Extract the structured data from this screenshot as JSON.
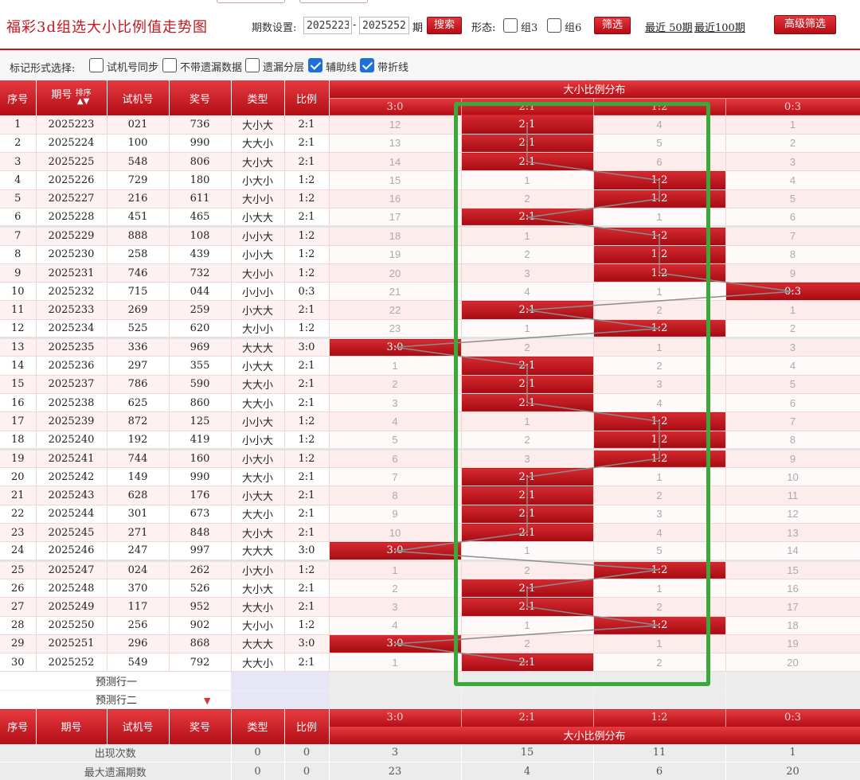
{
  "header": {
    "title": "福彩3d组选大小比例值走势图",
    "period_label": "期数设置:",
    "period_start": "2025223",
    "period_end": "2025252",
    "period_unit": "期",
    "search_label": "搜索",
    "shape_label": "形态:",
    "group3_label": "组3",
    "group6_label": "组6",
    "filter_label": "筛选",
    "recent50_label": "最近 50期",
    "recent100_label": "最近100期",
    "advanced_label": "高级筛选"
  },
  "options": {
    "label": "标记形式选择:",
    "items": [
      {
        "label": "试机号同步",
        "checked": false
      },
      {
        "label": "不带遗漏数据",
        "checked": false
      },
      {
        "label": "遗漏分层",
        "checked": false
      },
      {
        "label": "辅助线",
        "checked": true
      },
      {
        "label": "带折线",
        "checked": true
      }
    ]
  },
  "table": {
    "col_index": "序号",
    "col_period": "期号",
    "sort_label": "排序",
    "col_trial": "试机号",
    "col_prize": "奖号",
    "col_type": "类型",
    "col_ratio": "比例",
    "dist_title": "大小比例分布",
    "dist_cols": [
      "3:0",
      "2:1",
      "1:2",
      "0:3"
    ],
    "rows": [
      {
        "idx": "1",
        "period": "2025223",
        "trial": "021",
        "prize": "736",
        "type": "大小大",
        "ratio": "2:1",
        "dist": [
          "12",
          "2:1",
          "4",
          "1"
        ]
      },
      {
        "idx": "2",
        "period": "2025224",
        "trial": "100",
        "prize": "990",
        "type": "大大小",
        "ratio": "2:1",
        "dist": [
          "13",
          "2:1",
          "5",
          "2"
        ]
      },
      {
        "idx": "3",
        "period": "2025225",
        "trial": "548",
        "prize": "806",
        "type": "大小大",
        "ratio": "2:1",
        "dist": [
          "14",
          "2:1",
          "6",
          "3"
        ]
      },
      {
        "idx": "4",
        "period": "2025226",
        "trial": "729",
        "prize": "180",
        "type": "小大小",
        "ratio": "1:2",
        "dist": [
          "15",
          "1",
          "1:2",
          "4"
        ]
      },
      {
        "idx": "5",
        "period": "2025227",
        "trial": "216",
        "prize": "611",
        "type": "大小小",
        "ratio": "1:2",
        "dist": [
          "16",
          "2",
          "1:2",
          "5"
        ]
      },
      {
        "idx": "6",
        "period": "2025228",
        "trial": "451",
        "prize": "465",
        "type": "小大大",
        "ratio": "2:1",
        "dist": [
          "17",
          "2:1",
          "1",
          "6"
        ]
      },
      {
        "idx": "7",
        "period": "2025229",
        "trial": "888",
        "prize": "108",
        "type": "小小大",
        "ratio": "1:2",
        "dist": [
          "18",
          "1",
          "1:2",
          "7"
        ]
      },
      {
        "idx": "8",
        "period": "2025230",
        "trial": "258",
        "prize": "439",
        "type": "小小大",
        "ratio": "1:2",
        "dist": [
          "19",
          "2",
          "1:2",
          "8"
        ]
      },
      {
        "idx": "9",
        "period": "2025231",
        "trial": "746",
        "prize": "732",
        "type": "大小小",
        "ratio": "1:2",
        "dist": [
          "20",
          "3",
          "1:2",
          "9"
        ]
      },
      {
        "idx": "10",
        "period": "2025232",
        "trial": "715",
        "prize": "044",
        "type": "小小小",
        "ratio": "0:3",
        "dist": [
          "21",
          "4",
          "1",
          "0:3"
        ]
      },
      {
        "idx": "11",
        "period": "2025233",
        "trial": "269",
        "prize": "259",
        "type": "小大大",
        "ratio": "2:1",
        "dist": [
          "22",
          "2:1",
          "2",
          "1"
        ]
      },
      {
        "idx": "12",
        "period": "2025234",
        "trial": "525",
        "prize": "620",
        "type": "大小小",
        "ratio": "1:2",
        "dist": [
          "23",
          "1",
          "1:2",
          "2"
        ]
      },
      {
        "idx": "13",
        "period": "2025235",
        "trial": "336",
        "prize": "969",
        "type": "大大大",
        "ratio": "3:0",
        "dist": [
          "3:0",
          "2",
          "1",
          "3"
        ]
      },
      {
        "idx": "14",
        "period": "2025236",
        "trial": "297",
        "prize": "355",
        "type": "小大大",
        "ratio": "2:1",
        "dist": [
          "1",
          "2:1",
          "2",
          "4"
        ]
      },
      {
        "idx": "15",
        "period": "2025237",
        "trial": "786",
        "prize": "590",
        "type": "大大小",
        "ratio": "2:1",
        "dist": [
          "2",
          "2:1",
          "3",
          "5"
        ]
      },
      {
        "idx": "16",
        "period": "2025238",
        "trial": "625",
        "prize": "860",
        "type": "大大小",
        "ratio": "2:1",
        "dist": [
          "3",
          "2:1",
          "4",
          "6"
        ]
      },
      {
        "idx": "17",
        "period": "2025239",
        "trial": "872",
        "prize": "125",
        "type": "小小大",
        "ratio": "1:2",
        "dist": [
          "4",
          "1",
          "1:2",
          "7"
        ]
      },
      {
        "idx": "18",
        "period": "2025240",
        "trial": "192",
        "prize": "419",
        "type": "小小大",
        "ratio": "1:2",
        "dist": [
          "5",
          "2",
          "1:2",
          "8"
        ]
      },
      {
        "idx": "19",
        "period": "2025241",
        "trial": "744",
        "prize": "160",
        "type": "小大小",
        "ratio": "1:2",
        "dist": [
          "6",
          "3",
          "1:2",
          "9"
        ]
      },
      {
        "idx": "20",
        "period": "2025242",
        "trial": "149",
        "prize": "990",
        "type": "大大小",
        "ratio": "2:1",
        "dist": [
          "7",
          "2:1",
          "1",
          "10"
        ]
      },
      {
        "idx": "21",
        "period": "2025243",
        "trial": "628",
        "prize": "176",
        "type": "小大大",
        "ratio": "2:1",
        "dist": [
          "8",
          "2:1",
          "2",
          "11"
        ]
      },
      {
        "idx": "22",
        "period": "2025244",
        "trial": "301",
        "prize": "673",
        "type": "大大小",
        "ratio": "2:1",
        "dist": [
          "9",
          "2:1",
          "3",
          "12"
        ]
      },
      {
        "idx": "23",
        "period": "2025245",
        "trial": "271",
        "prize": "848",
        "type": "大小大",
        "ratio": "2:1",
        "dist": [
          "10",
          "2:1",
          "4",
          "13"
        ]
      },
      {
        "idx": "24",
        "period": "2025246",
        "trial": "247",
        "prize": "997",
        "type": "大大大",
        "ratio": "3:0",
        "dist": [
          "3:0",
          "1",
          "5",
          "14"
        ]
      },
      {
        "idx": "25",
        "period": "2025247",
        "trial": "024",
        "prize": "262",
        "type": "小大小",
        "ratio": "1:2",
        "dist": [
          "1",
          "2",
          "1:2",
          "15"
        ]
      },
      {
        "idx": "26",
        "period": "2025248",
        "trial": "370",
        "prize": "526",
        "type": "大小大",
        "ratio": "2:1",
        "dist": [
          "2",
          "2:1",
          "1",
          "16"
        ]
      },
      {
        "idx": "27",
        "period": "2025249",
        "trial": "117",
        "prize": "952",
        "type": "大大小",
        "ratio": "2:1",
        "dist": [
          "3",
          "2:1",
          "2",
          "17"
        ]
      },
      {
        "idx": "28",
        "period": "2025250",
        "trial": "256",
        "prize": "902",
        "type": "大小小",
        "ratio": "1:2",
        "dist": [
          "4",
          "1",
          "1:2",
          "18"
        ]
      },
      {
        "idx": "29",
        "period": "2025251",
        "trial": "296",
        "prize": "868",
        "type": "大大大",
        "ratio": "3:0",
        "dist": [
          "3:0",
          "2",
          "1",
          "19"
        ]
      },
      {
        "idx": "30",
        "period": "2025252",
        "trial": "549",
        "prize": "792",
        "type": "大大小",
        "ratio": "2:1",
        "dist": [
          "1",
          "2:1",
          "2",
          "20"
        ]
      }
    ],
    "pred1": "预测行一",
    "pred2": "预测行二",
    "stats": [
      {
        "label": "出现次数",
        "type": "0",
        "ratio": "0",
        "dist": [
          "3",
          "15",
          "11",
          "1"
        ]
      },
      {
        "label": "最大遗漏期数",
        "type": "0",
        "ratio": "0",
        "dist": [
          "23",
          "4",
          "6",
          "20"
        ]
      }
    ]
  },
  "colors": {
    "accent": "#c8161d",
    "highlight_box": "#3aa93a",
    "checkbox": "#1e6fd9"
  }
}
